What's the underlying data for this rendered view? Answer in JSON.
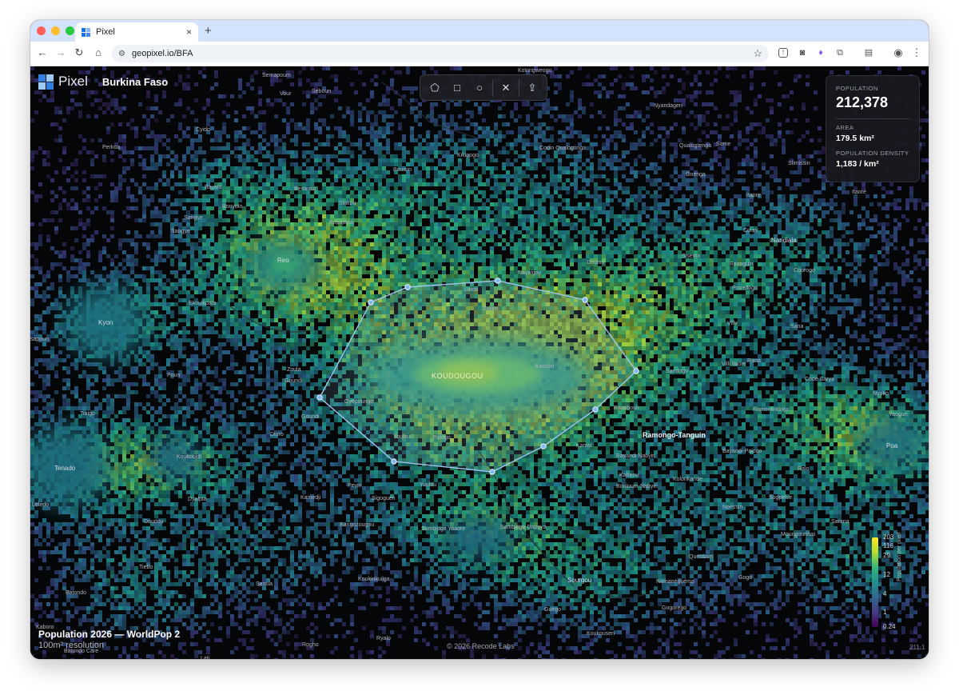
{
  "browser": {
    "tab_title": "Pixel",
    "url": "geopixel.io/BFA",
    "new_tab": "+",
    "tab_close": "×"
  },
  "app": {
    "brand": "Pixel",
    "country": "Burkina Faso"
  },
  "stats": {
    "population_label": "POPULATION",
    "population_value": "212,378",
    "area_label": "AREA",
    "area_value": "179.5 km²",
    "density_label": "POPULATION DENSITY",
    "density_value": "1,183 / km²"
  },
  "legend": {
    "ticks": [
      "203",
      "116",
      "29",
      "12",
      "4",
      "1",
      "0.24"
    ],
    "label": "Population per pixel"
  },
  "caption": {
    "title": "Population 2026 — WorldPop 2",
    "resolution": "100m² resolution"
  },
  "attribution": "© 2026 Recode Labs",
  "version": "211.1",
  "places": [
    {
      "name": "Semapoum",
      "cls": ""
    },
    {
      "name": "Seboun",
      "cls": ""
    },
    {
      "name": "Kolongweogo",
      "cls": ""
    },
    {
      "name": "Vour",
      "cls": ""
    },
    {
      "name": "Nyandagen",
      "cls": ""
    },
    {
      "name": "Cyido",
      "cls": ""
    },
    {
      "name": "Kikigogo",
      "cls": ""
    },
    {
      "name": "Codin Qualogtinga",
      "cls": ""
    },
    {
      "name": "Qualogtenga",
      "cls": ""
    },
    {
      "name": "Some",
      "cls": ""
    },
    {
      "name": "Perkoa",
      "cls": ""
    },
    {
      "name": "Bouisin",
      "cls": ""
    },
    {
      "name": "Slimissin",
      "cls": ""
    },
    {
      "name": "Gnenga",
      "cls": ""
    },
    {
      "name": "Bayalo",
      "cls": ""
    },
    {
      "name": "Benanso",
      "cls": ""
    },
    {
      "name": "Sinkou",
      "cls": ""
    },
    {
      "name": "Itaore",
      "cls": ""
    },
    {
      "name": "Itaoré",
      "cls": ""
    },
    {
      "name": "Bonyolo",
      "cls": ""
    },
    {
      "name": "Sangye",
      "cls": ""
    },
    {
      "name": "Kopopinzi",
      "cls": ""
    },
    {
      "name": "Sangye",
      "cls": ""
    },
    {
      "name": "Coury",
      "cls": ""
    },
    {
      "name": "Nandiala",
      "cls": "town"
    },
    {
      "name": "Reo",
      "cls": "town"
    },
    {
      "name": "Sisema",
      "cls": ""
    },
    {
      "name": "Baonguin",
      "cls": ""
    },
    {
      "name": "Doulou",
      "cls": ""
    },
    {
      "name": "Courogo",
      "cls": ""
    },
    {
      "name": "Nayalgay",
      "cls": ""
    },
    {
      "name": "Latou",
      "cls": ""
    },
    {
      "name": "Pouedogo",
      "cls": ""
    },
    {
      "name": "Ekoulkoala",
      "cls": ""
    },
    {
      "name": "Zaken",
      "cls": ""
    },
    {
      "name": "Kyon",
      "cls": "town"
    },
    {
      "name": "Villy",
      "cls": ""
    },
    {
      "name": "Sana",
      "cls": ""
    },
    {
      "name": "sapoun",
      "cls": ""
    },
    {
      "name": "Rana",
      "cls": ""
    },
    {
      "name": "Villi Itaore",
      "cls": ""
    },
    {
      "name": "Kassou",
      "cls": ""
    },
    {
      "name": "Zoula",
      "cls": ""
    },
    {
      "name": "KOUDOUGOU",
      "cls": "hub"
    },
    {
      "name": "Sandogo",
      "cls": ""
    },
    {
      "name": "Poun",
      "cls": ""
    },
    {
      "name": "Goundi",
      "cls": ""
    },
    {
      "name": "Code Sarya",
      "cls": ""
    },
    {
      "name": "Oyepoungo",
      "cls": ""
    },
    {
      "name": "Nyoko",
      "cls": ""
    },
    {
      "name": "Ramibouli",
      "cls": ""
    },
    {
      "name": "Ramonkodogo",
      "cls": ""
    },
    {
      "name": "Goundi",
      "cls": ""
    },
    {
      "name": "Yaogun",
      "cls": ""
    },
    {
      "name": "Tialgo",
      "cls": ""
    },
    {
      "name": "Dioro",
      "cls": ""
    },
    {
      "name": "Youlou",
      "cls": ""
    },
    {
      "name": "Palogo",
      "cls": ""
    },
    {
      "name": "Ramongo-Tanguin",
      "cls": "city"
    },
    {
      "name": "Kamsi",
      "cls": ""
    },
    {
      "name": "Poa",
      "cls": "town"
    },
    {
      "name": "Tenado",
      "cls": "town"
    },
    {
      "name": "Bayandi-Palogo",
      "cls": ""
    },
    {
      "name": "Koukouldi",
      "cls": ""
    },
    {
      "name": "Bayandi Nabyiri",
      "cls": ""
    },
    {
      "name": "Ralo",
      "cls": ""
    },
    {
      "name": "Kabirou",
      "cls": ""
    },
    {
      "name": "Kolonkande",
      "cls": ""
    },
    {
      "name": "Peyiri",
      "cls": ""
    },
    {
      "name": "Youlou",
      "cls": ""
    },
    {
      "name": "Bouloum-Nabyiri",
      "cls": ""
    },
    {
      "name": "Leledo",
      "cls": ""
    },
    {
      "name": "Kamedji",
      "cls": ""
    },
    {
      "name": "Sigoguen",
      "cls": ""
    },
    {
      "name": "Sogpelce",
      "cls": ""
    },
    {
      "name": "Dyalpia",
      "cls": ""
    },
    {
      "name": "Noessin",
      "cls": ""
    },
    {
      "name": "Sarana",
      "cls": ""
    },
    {
      "name": "Bangozougou",
      "cls": ""
    },
    {
      "name": "Sambiogo Yitaore",
      "cls": ""
    },
    {
      "name": "Sambiogo Dapoya",
      "cls": ""
    },
    {
      "name": "Doudou",
      "cls": ""
    },
    {
      "name": "Moungounissi",
      "cls": ""
    },
    {
      "name": "Quessam",
      "cls": ""
    },
    {
      "name": "Tiebo",
      "cls": ""
    },
    {
      "name": "Koukinkuilga",
      "cls": ""
    },
    {
      "name": "Sassia",
      "cls": ""
    },
    {
      "name": "Sourgou",
      "cls": "town"
    },
    {
      "name": "Namanéguéma",
      "cls": ""
    },
    {
      "name": "Gogo",
      "cls": ""
    },
    {
      "name": "Batondo",
      "cls": ""
    },
    {
      "name": "Gogorego",
      "cls": ""
    },
    {
      "name": "Guirgo",
      "cls": ""
    },
    {
      "name": "Kaboro",
      "cls": ""
    },
    {
      "name": "Koukousen",
      "cls": ""
    },
    {
      "name": "Rogho",
      "cls": ""
    },
    {
      "name": "Ryalo",
      "cls": ""
    },
    {
      "name": "Batondo Care",
      "cls": ""
    },
    {
      "name": "Lati",
      "cls": ""
    }
  ]
}
